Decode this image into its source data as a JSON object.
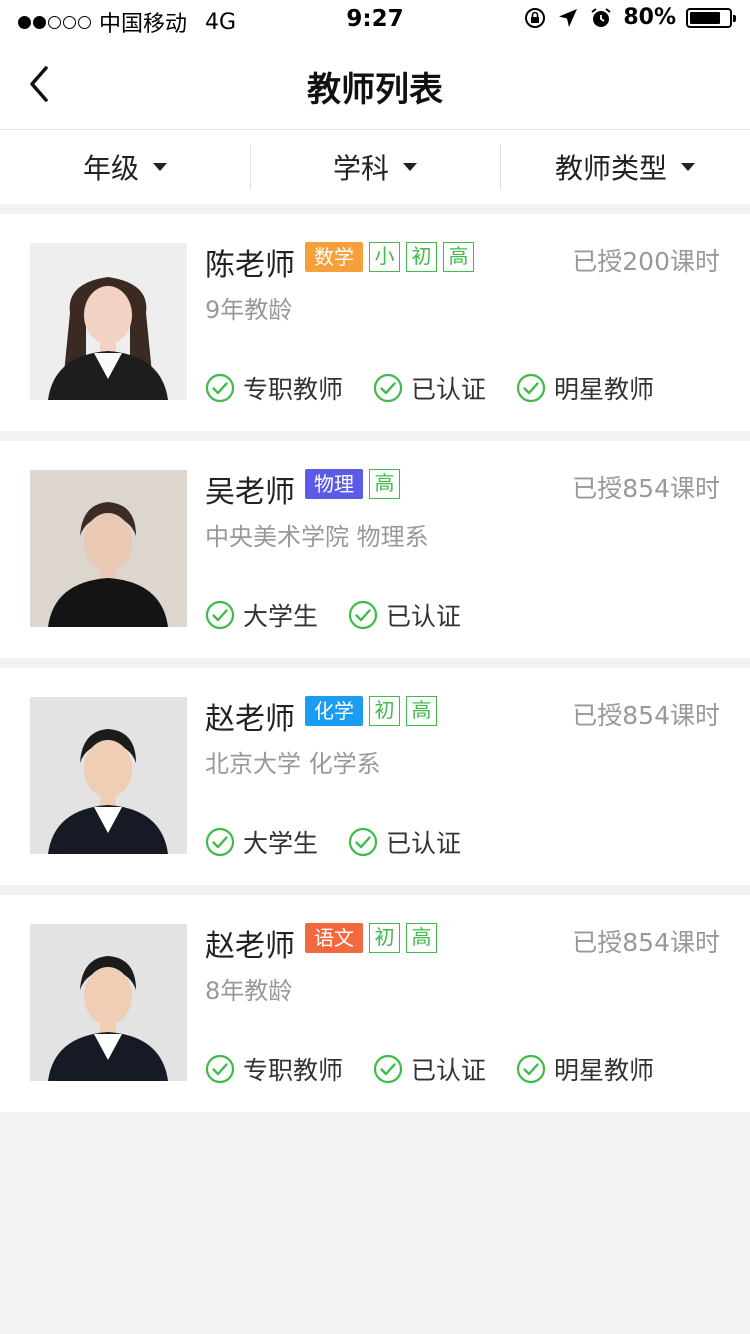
{
  "status_bar": {
    "carrier": "中国移动",
    "network": "4G",
    "time": "9:27",
    "battery": "80%",
    "battery_level": 0.8,
    "signal_dots_filled": 2,
    "signal_dots_total": 5
  },
  "nav": {
    "title": "教师列表",
    "back_icon": "chevron-left-icon"
  },
  "filters": [
    {
      "label": "年级"
    },
    {
      "label": "学科"
    },
    {
      "label": "教师类型"
    }
  ],
  "colors": {
    "math": "#f6a03b",
    "physics": "#5b5be7",
    "chemistry": "#1a9cf0",
    "chinese": "#f2683f",
    "green": "#3fbb4a",
    "gray_text": "#999999"
  },
  "teachers": [
    {
      "name": "陈老师",
      "subject": "数学",
      "levels": [
        "小",
        "初",
        "高"
      ],
      "hours": "已授200课时",
      "desc": "9年教龄",
      "badges": [
        "专职教师",
        "已认证",
        "明星教师"
      ]
    },
    {
      "name": "吴老师",
      "subject": "物理",
      "levels": [
        "高"
      ],
      "hours": "已授854课时",
      "desc": "中央美术学院   物理系",
      "badges": [
        "大学生",
        "已认证"
      ]
    },
    {
      "name": "赵老师",
      "subject": "化学",
      "levels": [
        "初",
        "高"
      ],
      "hours": "已授854课时",
      "desc": "北京大学  化学系",
      "badges": [
        "大学生",
        "已认证"
      ]
    },
    {
      "name": "赵老师",
      "subject": "语文",
      "levels": [
        "初",
        "高"
      ],
      "hours": "已授854课时",
      "desc": "8年教龄",
      "badges": [
        "专职教师",
        "已认证",
        "明星教师"
      ]
    }
  ]
}
